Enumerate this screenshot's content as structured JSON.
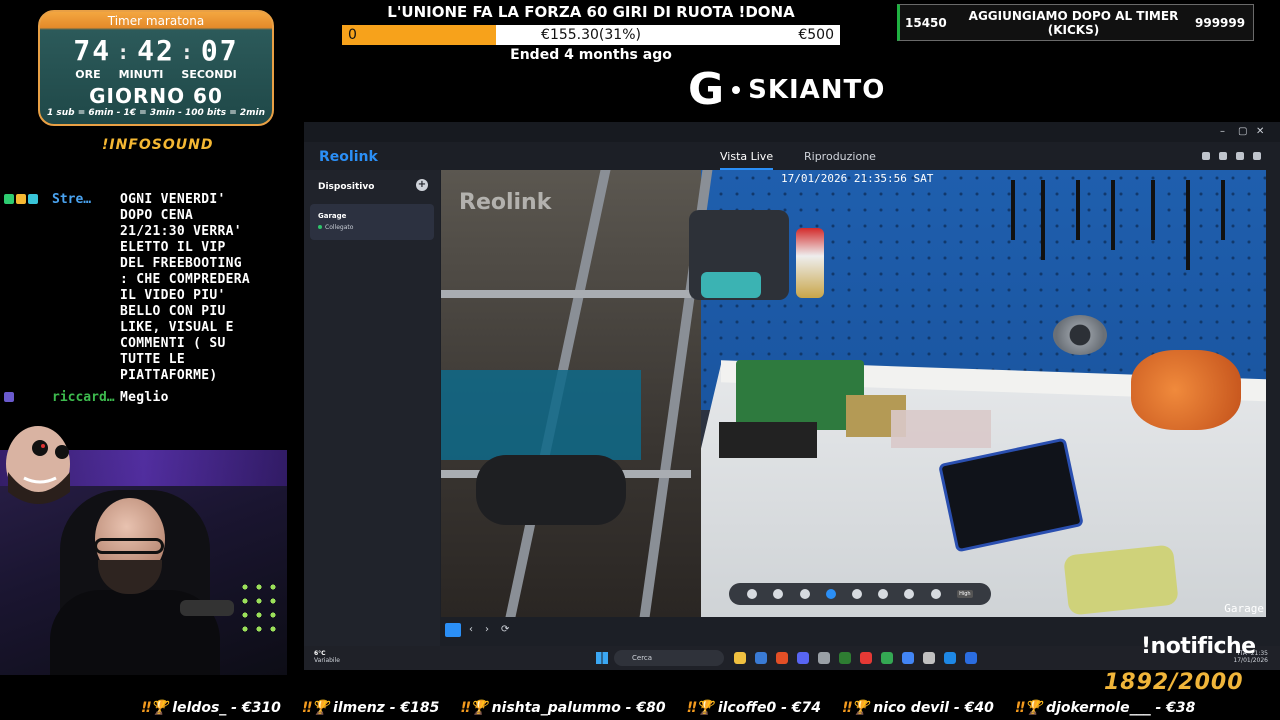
{
  "timer": {
    "title": "Timer maratona",
    "hours": "74",
    "minutes": "42",
    "seconds": "07",
    "label_hours": "ORE",
    "label_minutes": "MINUTI",
    "label_seconds": "SECONDI",
    "day": "GIORNO 60",
    "rates": "1 sub = 6min - 1€ = 3min - 100 bits = 2min"
  },
  "infosound": "!INFOSOUND",
  "chat": [
    {
      "user": "Stre…",
      "user_color": "#4aa3f0",
      "badges": [
        "#2ecc71",
        "#f5b833",
        "#39c5d9"
      ],
      "message": "OGNI VENERDI'\nDOPO CENA\n21/21:30 VERRA'\nELETTO IL VIP\nDEL FREEBOOTING\n: CHE COMPREDERA\nIL VIDEO PIU'\nBELLO CON PIU\nLIKE, VISUAL E\nCOMMENTI ( SU\nTUTTE LE\nPIATTAFORME)"
    },
    {
      "user": "riccard…",
      "user_color": "#3dba4e",
      "badges": [
        "#6a5acd"
      ],
      "message": "Meglio"
    }
  ],
  "goal": {
    "title": "L'UNIONE FA LA FORZA 60 GIRI DI RUOTA !DONA",
    "start": "0",
    "current": "€155.30(31%)",
    "end": "€500",
    "progress": 0.31,
    "status": "Ended 4 months ago"
  },
  "brand": {
    "letter": "G",
    "name": "SKIANTO"
  },
  "kicks": {
    "left": "15450",
    "center": "AGGIUNGIAMO DOPO AL TIMER (KICKS)",
    "right": "999999"
  },
  "reolink": {
    "brand": "Reolink",
    "tabs": [
      "Vista Live",
      "Riproduzione"
    ],
    "window_controls": [
      "–",
      "▢",
      "✕"
    ],
    "sidebar": {
      "title": "Dispositivo",
      "add_icon": "+",
      "device": {
        "name": "Garage",
        "status": "Collegato"
      }
    },
    "feed": {
      "watermark": "Reolink",
      "timestamp": "17/01/2026 21:35:56 SAT",
      "camera_name": "Garage",
      "controls": [
        "mic-icon",
        "settings-icon",
        "alarm-icon",
        "link-icon",
        "brush-icon",
        "ptz-icon",
        "record-icon",
        "snapshot-icon"
      ],
      "quality": "High"
    },
    "bottom_nav": [
      "‹",
      "›",
      "⟳"
    ]
  },
  "taskbar": {
    "weather_temp": "6°C",
    "weather_desc": "Variabile",
    "search": "Cerca",
    "apps": [
      "#f0c040",
      "#3a7bd5",
      "#e34f26",
      "#5865f2",
      "#9aa0a6",
      "#2e7d32",
      "#e53935",
      "#34a853",
      "#4285f4",
      "#c0c0c0",
      "#1e88e5",
      "#2b6de0"
    ],
    "lang": "ITA",
    "time": "21:35",
    "date": "17/01/2026"
  },
  "notifiche": "!notifiche",
  "counter": "1892/2000",
  "ticker": [
    {
      "text": "leldos_ - €310"
    },
    {
      "text": "ilmenz - €185"
    },
    {
      "text": "nishta_palummo - €80"
    },
    {
      "text": "ilcoffe0 - €74"
    },
    {
      "text": "nico devil - €40"
    },
    {
      "text": "djokernole___ - €38"
    }
  ],
  "colors": {
    "accent_orange": "#f7a21b",
    "reolink_blue": "#2b8ff6",
    "counter_gold": "#f0b53a"
  }
}
